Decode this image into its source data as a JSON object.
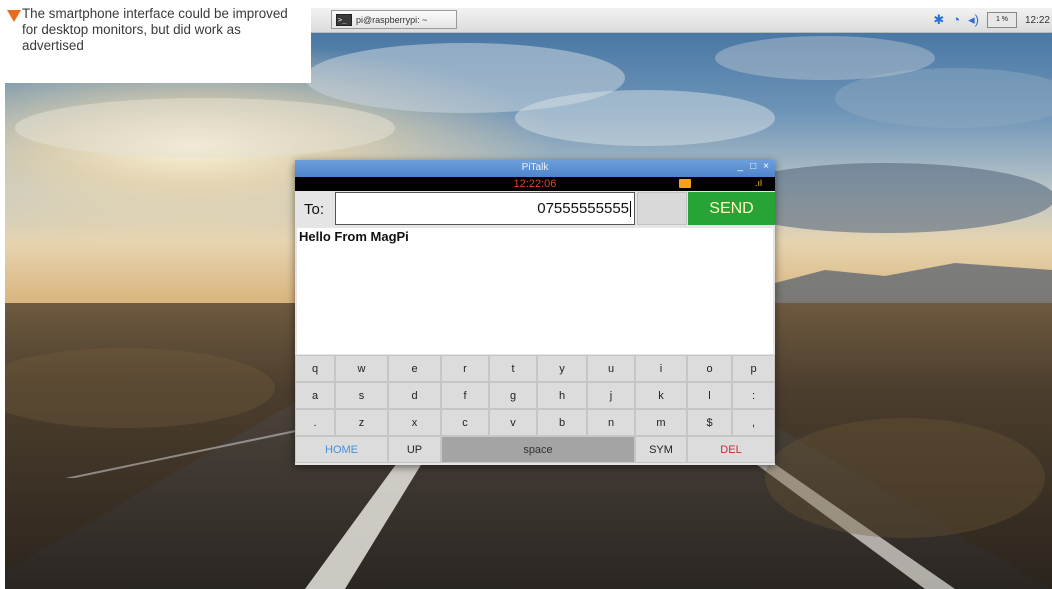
{
  "caption": {
    "text": "The smartphone interface could be improved for desktop monitors, but did work as advertised",
    "arrow_color": "#e86b1b"
  },
  "panel": {
    "terminal_icon": "terminal-icon",
    "task_label": "pi@raspberrypi: ~",
    "tray_icons": [
      "bluetooth-icon",
      "wifi-icon",
      "volume-icon",
      "cpu-monitor"
    ],
    "cpu_text": "1 %",
    "clock": "12:22"
  },
  "window": {
    "title": "PiTalk",
    "controls": [
      "_",
      "□",
      "×"
    ],
    "status": {
      "time": "12:22:06",
      "mail_icon": "mail-icon",
      "signal": ".ıl",
      "time_color": "#e8402a"
    },
    "to_label": "To:",
    "to_value": "07555555555",
    "send_label": "SEND",
    "send_color": "#28a336",
    "message": "Hello From MagPi"
  },
  "keyboard": {
    "row1": [
      "q",
      "w",
      "e",
      "r",
      "t",
      "y",
      "u",
      "i",
      "o",
      "p"
    ],
    "row2": [
      "a",
      "s",
      "d",
      "f",
      "g",
      "h",
      "j",
      "k",
      "l",
      ":"
    ],
    "row3": [
      ".",
      "z",
      "x",
      "c",
      "v",
      "b",
      "n",
      "m",
      "$",
      ","
    ],
    "home": "HOME",
    "up": "UP",
    "space": "space",
    "sym": "SYM",
    "del": "DEL"
  }
}
